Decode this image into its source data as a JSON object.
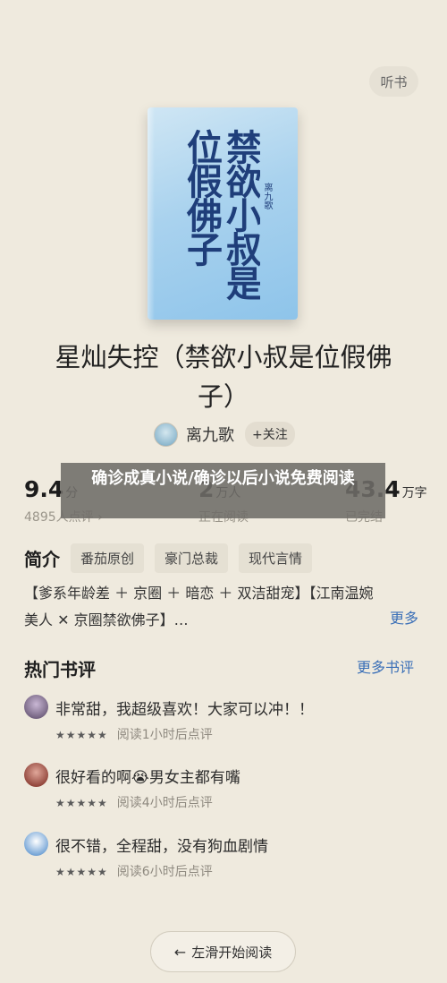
{
  "header": {
    "listen_label": "听书"
  },
  "cover": {
    "title": "禁欲小叔是位假佛子",
    "author": "离九歌"
  },
  "book": {
    "title": "星灿失控（禁欲小叔是位假佛子）"
  },
  "author": {
    "name": "离九歌",
    "follow_label": "+关注",
    "avatar_icon": "author-avatar"
  },
  "stats": {
    "rating": {
      "value": "9.4",
      "unit": "分",
      "label": "4895人点评 ›"
    },
    "readers": {
      "value": "2",
      "unit": "万人",
      "label": "正在阅读"
    },
    "words": {
      "value": "43.4",
      "unit": "万字",
      "label": "已完结"
    }
  },
  "banner": {
    "text": "确诊成真小说/确诊以后小说免费阅读"
  },
  "intro": {
    "title": "简介",
    "tags": [
      "番茄原创",
      "豪门总裁",
      "现代言情"
    ],
    "text": "【爹系年龄差 ＋ 京圈 ＋ 暗恋 ＋ 双洁甜宠】【江南温婉美人 ✕ 京圈禁欲佛子】…",
    "more_label": "更多"
  },
  "comments": {
    "title": "热门书评",
    "more_label": "更多书评",
    "items": [
      {
        "text": "非常甜，我超级喜欢！大家可以冲！！",
        "stars": "★★★★★",
        "meta": "阅读1小时后点评"
      },
      {
        "text": "很好看的啊😭男女主都有嘴",
        "stars": "★★★★★",
        "meta": "阅读4小时后点评"
      },
      {
        "text": "很不错，全程甜，没有狗血剧情",
        "stars": "★★★★★",
        "meta": "阅读6小时后点评"
      }
    ]
  },
  "footer": {
    "swipe_label": "左滑开始阅读",
    "arrow_icon": "arrow-left-icon"
  },
  "colors": {
    "background": "#efeade",
    "link": "#3a6fb7",
    "cover": "#a9d2ee"
  }
}
